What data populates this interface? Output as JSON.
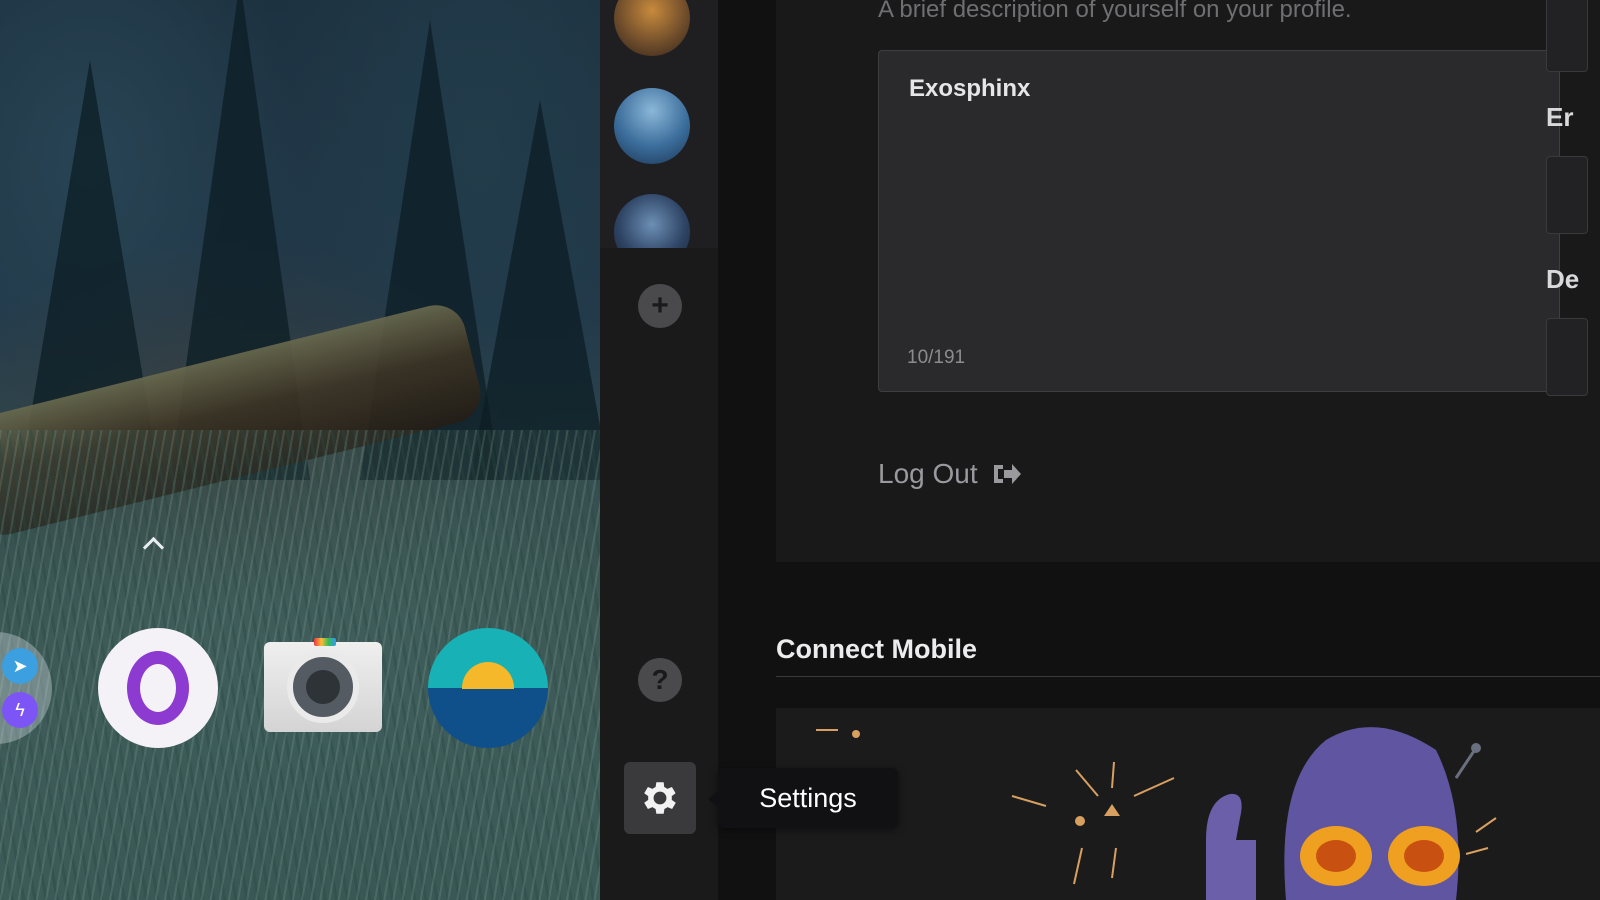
{
  "phone": {
    "dock_apps": [
      {
        "name": "Opera"
      },
      {
        "name": "Camera"
      },
      {
        "name": "Weather"
      }
    ]
  },
  "sidebar": {
    "tooltip": "Settings"
  },
  "profile": {
    "bio_description": "A brief description of yourself on your profile.",
    "bio_value": "Exosphinx",
    "bio_char_count": "10/191",
    "logout_label": "Log Out",
    "right_labels": [
      "Er",
      "De"
    ]
  },
  "connect_mobile": {
    "title": "Connect Mobile"
  },
  "colors": {
    "app_background": "#111112",
    "panel": "#19191a",
    "input": "#2a2a2c"
  },
  "icons": [
    "plus-icon",
    "question-icon",
    "gear-icon",
    "logout-icon",
    "telegram-icon",
    "messenger-icon"
  ]
}
